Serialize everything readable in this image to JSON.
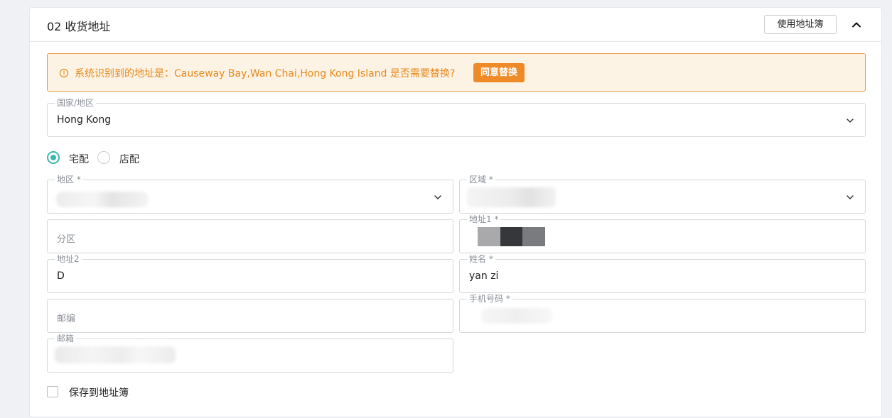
{
  "section": {
    "title": "02 收货地址",
    "address_book_button": "使用地址簿"
  },
  "alert": {
    "message": "系统识别到的地址是：Causeway Bay,Wan Chai,Hong Kong Island   是否需要替换?",
    "accept_button": "同意替换",
    "color": "#e88a1f"
  },
  "country": {
    "label": "国家/地区",
    "value": "Hong Kong"
  },
  "delivery": {
    "options": [
      "宅配",
      "店配"
    ],
    "selected": "宅配",
    "accent": "#3cb8b0"
  },
  "form": {
    "region_label": "地区 *",
    "area_label": "区域 *",
    "district_placeholder": "分区",
    "address1_label": "地址1 *",
    "address2_label": "地址2",
    "address2_value": "D",
    "name_label": "姓名 *",
    "name_value": "yan zi",
    "postcode_placeholder": "邮编",
    "phone_label": "手机号码 *",
    "email_label": "邮箱"
  },
  "save_to_book_label": "保存到地址簿"
}
